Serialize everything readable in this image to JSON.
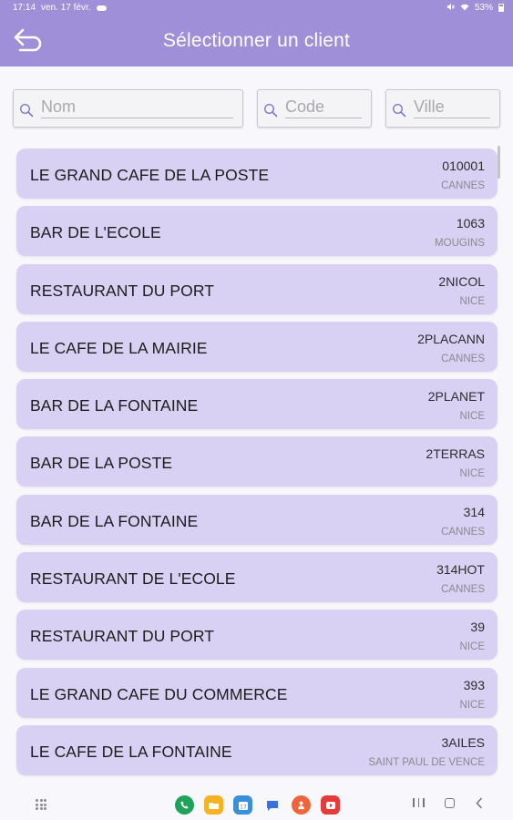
{
  "status_bar": {
    "time": "17:14",
    "date": "ven. 17 févr.",
    "battery": "53%"
  },
  "header": {
    "title": "Sélectionner un client",
    "back_icon": "back-arrow-icon"
  },
  "filters": {
    "name": {
      "placeholder": "Nom",
      "value": ""
    },
    "code": {
      "placeholder": "Code",
      "value": ""
    },
    "city": {
      "placeholder": "Ville",
      "value": ""
    }
  },
  "clients": [
    {
      "name": "LE GRAND CAFE DE LA POSTE",
      "code": "010001",
      "city": "CANNES"
    },
    {
      "name": "BAR DE L'ECOLE",
      "code": "1063",
      "city": "MOUGINS"
    },
    {
      "name": "RESTAURANT DU PORT",
      "code": "2NICOL",
      "city": "NICE"
    },
    {
      "name": "LE CAFE DE LA MAIRIE",
      "code": "2PLACANN",
      "city": "CANNES"
    },
    {
      "name": "BAR DE LA FONTAINE",
      "code": "2PLANET",
      "city": "NICE"
    },
    {
      "name": "BAR DE LA POSTE",
      "code": "2TERRAS",
      "city": "NICE"
    },
    {
      "name": "BAR DE LA FONTAINE",
      "code": "314",
      "city": "CANNES"
    },
    {
      "name": "RESTAURANT DE L'ECOLE",
      "code": "314HOT",
      "city": "CANNES"
    },
    {
      "name": "RESTAURANT DU PORT",
      "code": "39",
      "city": "NICE"
    },
    {
      "name": "LE GRAND CAFE DU COMMERCE",
      "code": "393",
      "city": "NICE"
    },
    {
      "name": "LE CAFE DE LA FONTAINE",
      "code": "3AILES",
      "city": "SAINT PAUL DE VENCE"
    }
  ],
  "colors": {
    "accent": "#9e8fd8",
    "row_background": "#d9d1f3",
    "background": "#f8f7fc"
  },
  "dock_apps": [
    {
      "icon": "phone-icon",
      "color": "#1fa25a"
    },
    {
      "icon": "folder-icon",
      "color": "#f4b324"
    },
    {
      "icon": "calendar-icon",
      "color": "#3a8fd8"
    },
    {
      "icon": "messages-icon",
      "color": "#3b6fe0"
    },
    {
      "icon": "contacts-icon",
      "color": "#f0643c"
    },
    {
      "icon": "youtube-icon",
      "color": "#e53b3b"
    }
  ]
}
